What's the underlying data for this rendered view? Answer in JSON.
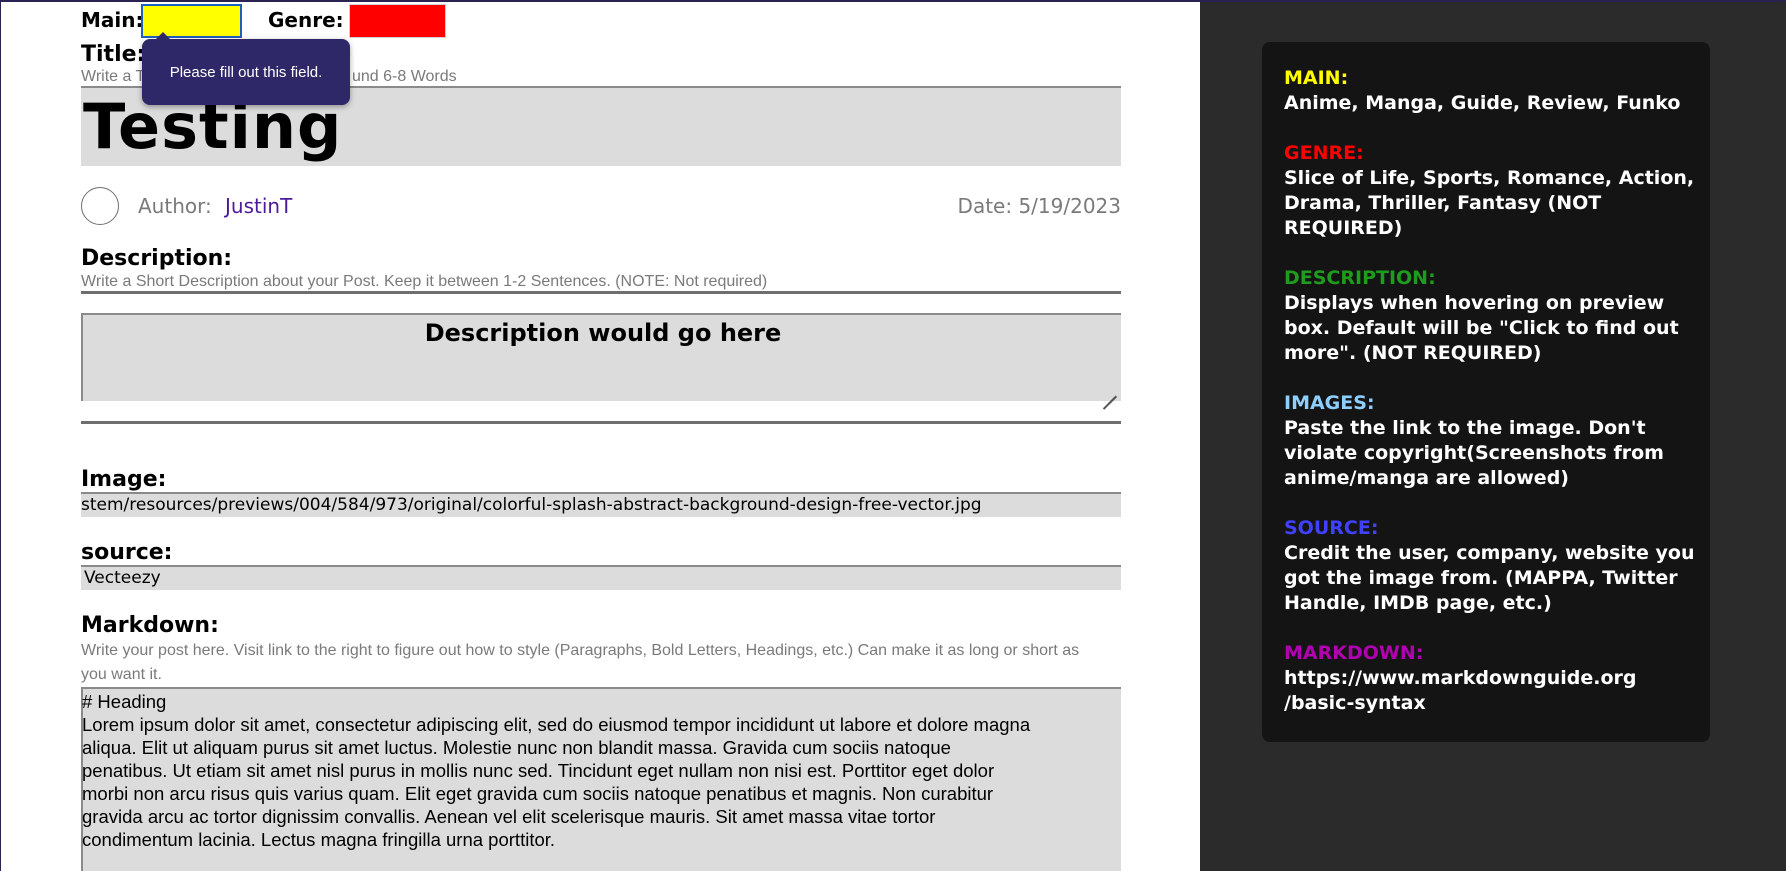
{
  "form": {
    "main_label": "Main:",
    "genre_label": "Genre:",
    "title_label": "Title:",
    "title_hint_start": "Write a T",
    "title_hint_end": "und 6-8 Words",
    "title_value": "Testing",
    "validation_tooltip": "Please fill out this field.",
    "author_label": "Author:",
    "author_name": "JustinT",
    "date_label": "Date: 5/19/2023",
    "description_label": "Description:",
    "description_hint": "Write a Short Description about your Post. Keep it between 1-2 Sentences. (NOTE: Not required)",
    "description_value": "Description would go here",
    "image_label": "Image:",
    "image_value": "stem/resources/previews/004/584/973/original/colorful-splash-abstract-background-design-free-vector.jpg",
    "source_label": "source:",
    "source_value": "Vecteezy",
    "markdown_label": "Markdown:",
    "markdown_hint_line1": "Write your post here. Visit link to the right to figure out how to style (Paragraphs, Bold Letters, Headings, etc.) Can make it as long or short as",
    "markdown_hint_line2": "you want it.",
    "markdown_heading": "# Heading",
    "markdown_body": [
      "Lorem ipsum dolor sit amet, consectetur adipiscing elit, sed do eiusmod tempor incididunt ut labore et dolore magna",
      "aliqua. Elit ut aliquam purus sit amet luctus. Molestie nunc non blandit massa. Gravida cum sociis natoque",
      "penatibus. Ut etiam sit amet nisl purus in mollis nunc sed. Tincidunt eget nullam non nisi est. Porttitor eget dolor",
      "morbi non arcu risus quis varius quam. Elit eget gravida cum sociis natoque penatibus et magnis. Non curabitur",
      "gravida arcu ac tortor dignissim convallis. Aenean vel elit scelerisque mauris. Sit amet massa vitae tortor",
      "condimentum lacinia. Lectus magna fringilla urna porttitor."
    ],
    "main_color": "#ffff00",
    "genre_color": "#ff0000"
  },
  "help": {
    "main_title": "MAIN:",
    "main_text": "Anime, Manga, Guide, Review, Funko",
    "genre_title": "GENRE:",
    "genre_text": "Slice of Life, Sports, Romance, Action, Drama, Thriller, Fantasy (NOT REQUIRED)",
    "description_title": "DESCRIPTION:",
    "description_text": "Displays when hovering on preview box. Default will be \"Click to find out more\". (NOT REQUIRED)",
    "images_title": "IMAGES:",
    "images_text": "Paste the link to the image. Don't violate copyright(Screenshots from anime/manga are allowed)",
    "source_title": "SOURCE:",
    "source_text": "Credit the user, company, website you got the image from. (MAPPA, Twitter Handle, IMDB page, etc.)",
    "markdown_title": "MARKDOWN:",
    "markdown_text_line1": "https://www.markdownguide.org",
    "markdown_text_line2": "/basic-syntax",
    "colors": {
      "main": "#ffff00",
      "genre": "#ff0000",
      "description": "#1e9c1e",
      "images": "#8ecfff",
      "source": "#4040ff",
      "markdown": "#b000b0"
    }
  }
}
